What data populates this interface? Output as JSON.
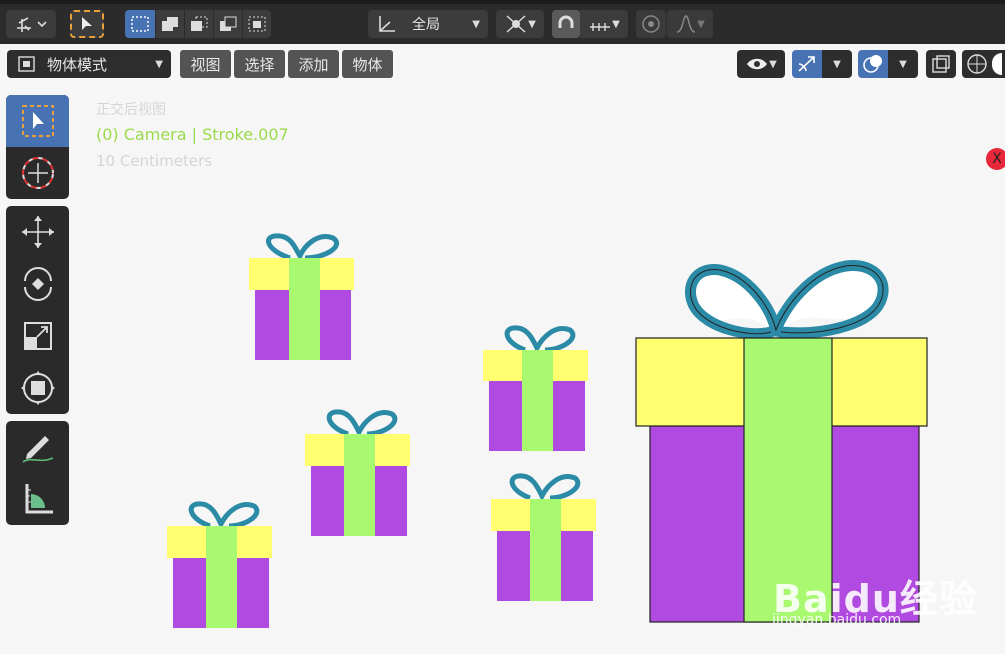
{
  "topbar": {
    "transform_orientation": "全局",
    "buttons": [
      "transform-pivot",
      "select-tool",
      "select-mode-set",
      "select-mode-extend",
      "select-mode-subtract",
      "select-mode-invert",
      "select-mode-intersect",
      "snap",
      "proportional-edit"
    ]
  },
  "header": {
    "mode": "物体模式",
    "menus": [
      "视图",
      "选择",
      "添加",
      "物体"
    ]
  },
  "overlay": {
    "view_name": "正交后视图",
    "object_info": "(0) Camera | Stroke.007",
    "scale": "10 Centimeters"
  },
  "close_label": "X",
  "watermark": {
    "brand": "Baidu经验",
    "url": "jingyan.baidu.com"
  },
  "colors": {
    "box_purple": "#b04ae0",
    "lid_yellow": "#ffff70",
    "ribbon_green": "#a8f870",
    "bow_teal": "#2b8aa6",
    "accent_blue": "#4772b3"
  }
}
